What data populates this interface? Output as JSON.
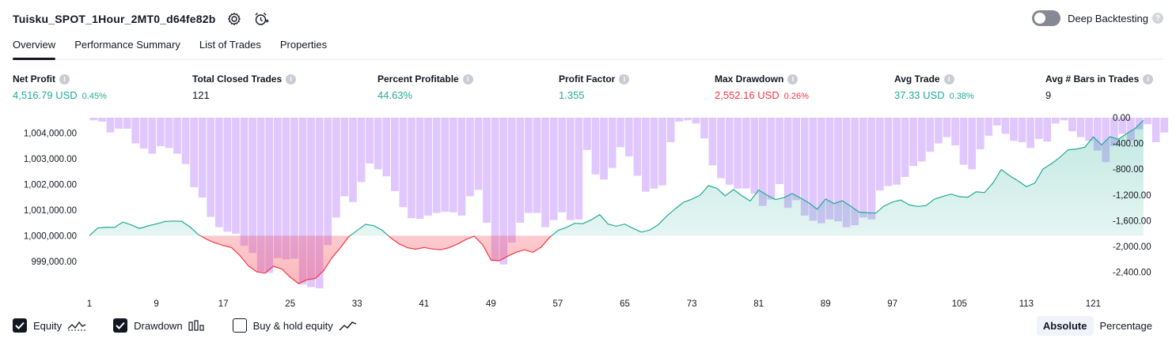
{
  "header": {
    "title": "Tuisku_SPOT_1Hour_2MT0_d64fe82b",
    "deep_backtesting_label": "Deep Backtesting",
    "help_glyph": "?"
  },
  "tabs": [
    {
      "label": "Overview",
      "active": true
    },
    {
      "label": "Performance Summary",
      "active": false
    },
    {
      "label": "List of Trades",
      "active": false
    },
    {
      "label": "Properties",
      "active": false
    }
  ],
  "metrics": [
    {
      "label": "Net Profit",
      "value": "4,516.79 USD",
      "pct": "0.45%",
      "color": "#22ab94"
    },
    {
      "label": "Total Closed Trades",
      "value": "121",
      "pct": "",
      "color": "#131722"
    },
    {
      "label": "Percent Profitable",
      "value": "44.63%",
      "pct": "",
      "color": "#22ab94"
    },
    {
      "label": "Profit Factor",
      "value": "1.355",
      "pct": "",
      "color": "#22ab94"
    },
    {
      "label": "Max Drawdown",
      "value": "2,552.16 USD",
      "pct": "0.26%",
      "color": "#f23645"
    },
    {
      "label": "Avg Trade",
      "value": "37.33 USD",
      "pct": "0.38%",
      "color": "#22ab94"
    },
    {
      "label": "Avg # Bars in Trades",
      "value": "9",
      "pct": "",
      "color": "#131722"
    }
  ],
  "legend": {
    "equity_label": "Equity",
    "equity_checked": true,
    "drawdown_label": "Drawdown",
    "drawdown_checked": true,
    "buyhold_label": "Buy & hold equity",
    "buyhold_checked": false
  },
  "modes": {
    "absolute": "Absolute",
    "percentage": "Percentage",
    "active": "absolute"
  },
  "colors": {
    "positive": "#22ab94",
    "negative": "#f23645",
    "drawdown_bar": "#d6b4fc",
    "accent_dark": "#131722"
  },
  "chart_data": {
    "type": "area",
    "x_ticks": [
      "1",
      "9",
      "17",
      "25",
      "33",
      "41",
      "49",
      "57",
      "65",
      "73",
      "81",
      "89",
      "97",
      "105",
      "113",
      "121"
    ],
    "x_range": [
      1,
      122
    ],
    "left_axis": {
      "labels": [
        "1,004,000.00",
        "1,003,000.00",
        "1,002,000.00",
        "1,001,000.00",
        "1,000,000.00",
        "999,000.00"
      ],
      "values": [
        1004000,
        1003000,
        1002000,
        1001000,
        1000000,
        999000
      ],
      "range": [
        998100,
        1004600
      ],
      "baseline": 1000000
    },
    "right_axis": {
      "labels": [
        "0.00",
        "-400.00",
        "-800.00",
        "-1,200.00",
        "-1,600.00",
        "-2,000.00",
        "-2,400.00"
      ],
      "values": [
        0,
        -400,
        -800,
        -1200,
        -1600,
        -2000,
        -2400
      ],
      "range": [
        -2650,
        0
      ]
    },
    "series": [
      {
        "name": "Equity",
        "values": [
          1000000,
          1000300,
          1000330,
          1000320,
          1000530,
          1000420,
          1000280,
          1000380,
          1000460,
          1000550,
          1000570,
          1000560,
          1000350,
          1000050,
          999860,
          999720,
          999620,
          999530,
          999220,
          998820,
          998590,
          998540,
          998810,
          998700,
          998380,
          998130,
          998280,
          998330,
          998640,
          999140,
          999530,
          999960,
          1000200,
          1000440,
          1000390,
          1000210,
          999920,
          999680,
          999530,
          999470,
          999540,
          999480,
          999450,
          999530,
          999670,
          999850,
          999980,
          999650,
          999050,
          999020,
          999200,
          999350,
          999450,
          999350,
          999550,
          999930,
          1000200,
          1000320,
          1000480,
          1000470,
          1000620,
          1000820,
          1000450,
          1000370,
          1000450,
          1000280,
          1000140,
          1000220,
          1000430,
          1000760,
          1001040,
          1001300,
          1001420,
          1001580,
          1001950,
          1001850,
          1001550,
          1001800,
          1001560,
          1001350,
          1001780,
          1001580,
          1001410,
          1001480,
          1001640,
          1001470,
          1001280,
          1001030,
          1001430,
          1001250,
          1001360,
          1001150,
          1000920,
          1000890,
          1000880,
          1001160,
          1001310,
          1001390,
          1001200,
          1001140,
          1001170,
          1001420,
          1001530,
          1001620,
          1001520,
          1001500,
          1001710,
          1001680,
          1002050,
          1002580,
          1002340,
          1002140,
          1001910,
          1002050,
          1002600,
          1002810,
          1003050,
          1003350,
          1003380,
          1003450,
          1003850,
          1003540,
          1003860,
          1003760,
          1003980,
          1004180,
          1004500
        ]
      },
      {
        "name": "Drawdown",
        "values": [
          -40,
          -60,
          -230,
          -170,
          -170,
          -400,
          -480,
          -560,
          -440,
          -470,
          -560,
          -720,
          -1080,
          -1240,
          -1540,
          -1700,
          -1770,
          -1800,
          -1990,
          -2100,
          -2390,
          -2410,
          -2180,
          -2200,
          -2190,
          -2590,
          -2630,
          -2650,
          -1980,
          -1550,
          -1220,
          -1310,
          -1000,
          -710,
          -800,
          -910,
          -1140,
          -1390,
          -1560,
          -1570,
          -1520,
          -1480,
          -1460,
          -1470,
          -1520,
          -1220,
          -1120,
          -1630,
          -2230,
          -2280,
          -1940,
          -1630,
          -1480,
          -1480,
          -1700,
          -1590,
          -1470,
          -1590,
          -1580,
          -500,
          -880,
          -960,
          -780,
          -460,
          -600,
          -900,
          -1150,
          -1100,
          -1050,
          -380,
          -60,
          -40,
          -90,
          -320,
          -740,
          -940,
          -1040,
          -1100,
          -1100,
          -1180,
          -1370,
          -1270,
          -1030,
          -1400,
          -1280,
          -1520,
          -1600,
          -1640,
          -1580,
          -1610,
          -1700,
          -1670,
          -1550,
          -1580,
          -1130,
          -1060,
          -1040,
          -920,
          -750,
          -680,
          -530,
          -400,
          -300,
          -430,
          -730,
          -800,
          -490,
          -280,
          -120,
          -250,
          -360,
          -380,
          -470,
          -330,
          -370,
          -90,
          -40,
          -210,
          -300,
          -360,
          -510,
          -690,
          -440,
          -250,
          -360,
          -180,
          -100,
          -380,
          -230
        ]
      }
    ]
  }
}
